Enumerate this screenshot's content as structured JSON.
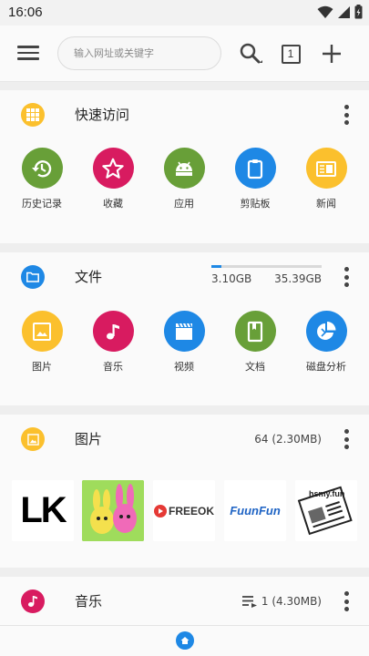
{
  "status_bar": {
    "time": "16:06"
  },
  "toolbar": {
    "search_placeholder": "输入网址或关键字",
    "tab_count": "1"
  },
  "quick_access": {
    "title": "快速访问",
    "icon_color": "#fbc02d",
    "items": [
      {
        "label": "历史记录",
        "icon": "history-icon",
        "color": "#689f38"
      },
      {
        "label": "收藏",
        "icon": "star-icon",
        "color": "#d81b60"
      },
      {
        "label": "应用",
        "icon": "android-icon",
        "color": "#689f38"
      },
      {
        "label": "剪贴板",
        "icon": "clipboard-icon",
        "color": "#1e88e5"
      },
      {
        "label": "新闻",
        "icon": "news-icon",
        "color": "#fbc02d"
      }
    ]
  },
  "files": {
    "title": "文件",
    "icon_color": "#1e88e5",
    "used": "3.10GB",
    "total": "35.39GB",
    "used_fraction": 0.088,
    "items": [
      {
        "label": "图片",
        "icon": "image-icon",
        "color": "#fbc02d"
      },
      {
        "label": "音乐",
        "icon": "music-note-icon",
        "color": "#d81b60"
      },
      {
        "label": "视频",
        "icon": "video-icon",
        "color": "#1e88e5"
      },
      {
        "label": "文档",
        "icon": "document-icon",
        "color": "#689f38"
      },
      {
        "label": "磁盘分析",
        "icon": "pie-chart-icon",
        "color": "#1e88e5"
      }
    ]
  },
  "pictures": {
    "title": "图片",
    "icon_color": "#fbc02d",
    "count": "64 (2.30MB)",
    "thumbs": [
      {
        "text": "LK"
      },
      {
        "text": ""
      },
      {
        "text": "FREEOK"
      },
      {
        "text": "FuunFun"
      },
      {
        "text": "hsmy.fun"
      }
    ]
  },
  "music": {
    "title": "音乐",
    "icon_color": "#d81b60",
    "count": "1 (4.30MB)"
  }
}
